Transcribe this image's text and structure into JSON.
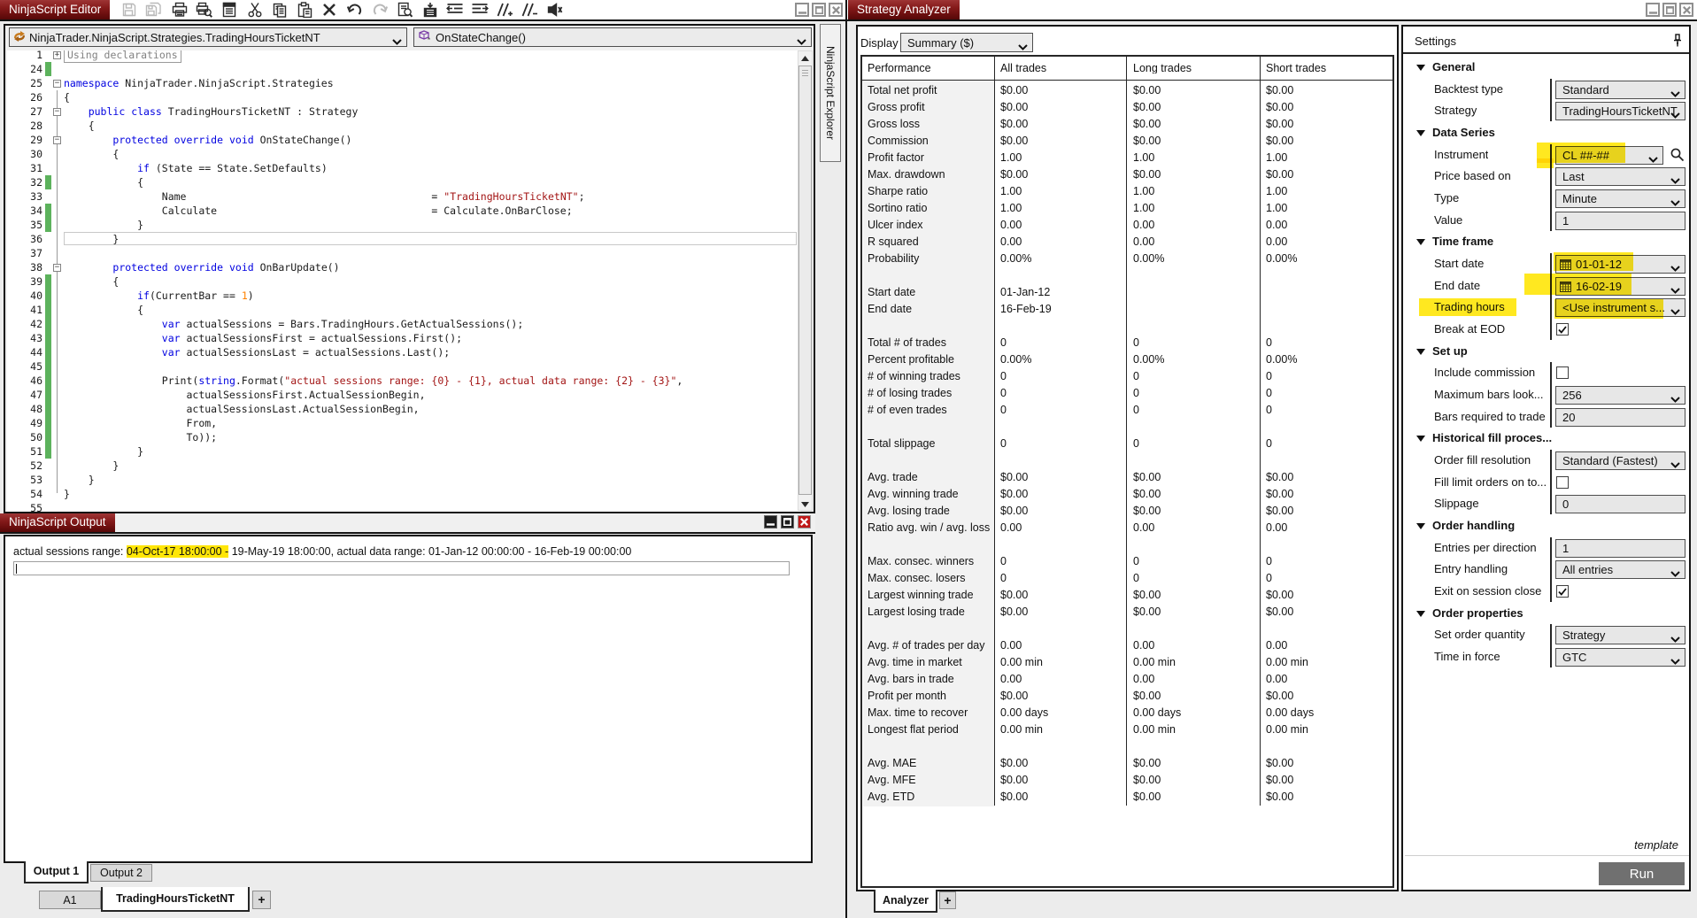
{
  "editor": {
    "title": "NinjaScript Editor",
    "toolbar": [
      {
        "name": "save",
        "disabled": true
      },
      {
        "name": "save-all",
        "disabled": true
      },
      {
        "name": "print",
        "disabled": false
      },
      {
        "name": "print-preview",
        "disabled": false
      },
      {
        "name": "template",
        "disabled": false
      },
      {
        "name": "cut",
        "disabled": false
      },
      {
        "name": "copy",
        "disabled": false
      },
      {
        "name": "paste",
        "disabled": false
      },
      {
        "name": "delete",
        "disabled": false
      },
      {
        "name": "undo",
        "disabled": false
      },
      {
        "name": "redo",
        "disabled": true
      },
      {
        "name": "find",
        "disabled": false
      },
      {
        "name": "compile",
        "disabled": false
      },
      {
        "name": "outdent",
        "disabled": false
      },
      {
        "name": "indent",
        "disabled": false
      },
      {
        "name": "comment",
        "disabled": false
      },
      {
        "name": "uncomment",
        "disabled": false
      },
      {
        "name": "mute",
        "disabled": false
      }
    ],
    "class_dropdown": "NinjaTrader.NinjaScript.Strategies.TradingHoursTicketNT",
    "method_dropdown": "OnStateChange()",
    "explorer_tab": "NinjaScript Explorer",
    "collapsed_region": "Using declarations",
    "code_lines": [
      {
        "num": "1",
        "green": false,
        "fold": "plus",
        "collapsed": true,
        "tokens": []
      },
      {
        "num": "24",
        "green": true,
        "fold": "",
        "tokens": []
      },
      {
        "num": "25",
        "green": false,
        "fold": "minus",
        "tokens": [
          [
            "k",
            "namespace"
          ],
          [
            "p",
            " NinjaTrader.NinjaScript.Strategies"
          ]
        ]
      },
      {
        "num": "26",
        "green": false,
        "fold": "",
        "tokens": [
          [
            "p",
            "{"
          ]
        ]
      },
      {
        "num": "27",
        "green": false,
        "fold": "minus",
        "tokens": [
          [
            "p",
            "    "
          ],
          [
            "k",
            "public"
          ],
          [
            "p",
            " "
          ],
          [
            "k",
            "class"
          ],
          [
            "p",
            " TradingHoursTicketNT : Strategy"
          ]
        ]
      },
      {
        "num": "28",
        "green": false,
        "fold": "",
        "tokens": [
          [
            "p",
            "    {"
          ]
        ]
      },
      {
        "num": "29",
        "green": false,
        "fold": "minus",
        "tokens": [
          [
            "p",
            "        "
          ],
          [
            "k",
            "protected"
          ],
          [
            "p",
            " "
          ],
          [
            "k",
            "override"
          ],
          [
            "p",
            " "
          ],
          [
            "k",
            "void"
          ],
          [
            "p",
            " OnStateChange()"
          ]
        ]
      },
      {
        "num": "30",
        "green": false,
        "fold": "",
        "tokens": [
          [
            "p",
            "        {"
          ]
        ]
      },
      {
        "num": "31",
        "green": false,
        "fold": "",
        "tokens": [
          [
            "p",
            "            "
          ],
          [
            "k",
            "if"
          ],
          [
            "p",
            " (State == State.SetDefaults)"
          ]
        ]
      },
      {
        "num": "32",
        "green": true,
        "fold": "",
        "tokens": [
          [
            "p",
            "            {"
          ]
        ]
      },
      {
        "num": "33",
        "green": false,
        "fold": "",
        "tokens": [
          [
            "p",
            "                Name                                        = "
          ],
          [
            "s",
            "\"TradingHoursTicketNT\""
          ],
          [
            "p",
            ";"
          ]
        ]
      },
      {
        "num": "34",
        "green": true,
        "fold": "",
        "tokens": [
          [
            "p",
            "                Calculate                                   = Calculate.OnBarClose;"
          ]
        ]
      },
      {
        "num": "35",
        "green": true,
        "fold": "",
        "tokens": [
          [
            "p",
            "            }"
          ]
        ]
      },
      {
        "num": "36",
        "green": false,
        "fold": "",
        "caret": true,
        "tokens": [
          [
            "p",
            "        }"
          ]
        ]
      },
      {
        "num": "37",
        "green": false,
        "fold": "",
        "tokens": []
      },
      {
        "num": "38",
        "green": false,
        "fold": "minus",
        "tokens": [
          [
            "p",
            "        "
          ],
          [
            "k",
            "protected"
          ],
          [
            "p",
            " "
          ],
          [
            "k",
            "override"
          ],
          [
            "p",
            " "
          ],
          [
            "k",
            "void"
          ],
          [
            "p",
            " OnBarUpdate()"
          ]
        ]
      },
      {
        "num": "39",
        "green": true,
        "fold": "",
        "tokens": [
          [
            "p",
            "        {"
          ]
        ]
      },
      {
        "num": "40",
        "green": true,
        "fold": "",
        "tokens": [
          [
            "p",
            "            "
          ],
          [
            "k",
            "if"
          ],
          [
            "p",
            "(CurrentBar == "
          ],
          [
            "n",
            "1"
          ],
          [
            "p",
            ")"
          ]
        ]
      },
      {
        "num": "41",
        "green": true,
        "fold": "",
        "tokens": [
          [
            "p",
            "            {"
          ]
        ]
      },
      {
        "num": "42",
        "green": true,
        "fold": "",
        "tokens": [
          [
            "p",
            "                "
          ],
          [
            "k",
            "var"
          ],
          [
            "p",
            " actualSessions = Bars.TradingHours.GetActualSessions();"
          ]
        ]
      },
      {
        "num": "43",
        "green": true,
        "fold": "",
        "tokens": [
          [
            "p",
            "                "
          ],
          [
            "k",
            "var"
          ],
          [
            "p",
            " actualSessionsFirst = actualSessions.First();"
          ]
        ]
      },
      {
        "num": "44",
        "green": true,
        "fold": "",
        "tokens": [
          [
            "p",
            "                "
          ],
          [
            "k",
            "var"
          ],
          [
            "p",
            " actualSessionsLast = actualSessions.Last();"
          ]
        ]
      },
      {
        "num": "45",
        "green": true,
        "fold": "",
        "tokens": []
      },
      {
        "num": "46",
        "green": true,
        "fold": "",
        "tokens": [
          [
            "p",
            "                Print("
          ],
          [
            "k",
            "string"
          ],
          [
            "p",
            ".Format("
          ],
          [
            "s",
            "\"actual sessions range: {0} - {1}, actual data range: {2} - {3}\""
          ],
          [
            "p",
            ","
          ]
        ]
      },
      {
        "num": "47",
        "green": true,
        "fold": "",
        "tokens": [
          [
            "p",
            "                    actualSessionsFirst.ActualSessionBegin,"
          ]
        ]
      },
      {
        "num": "48",
        "green": true,
        "fold": "",
        "tokens": [
          [
            "p",
            "                    actualSessionsLast.ActualSessionBegin,"
          ]
        ]
      },
      {
        "num": "49",
        "green": true,
        "fold": "",
        "tokens": [
          [
            "p",
            "                    From,"
          ]
        ]
      },
      {
        "num": "50",
        "green": true,
        "fold": "",
        "tokens": [
          [
            "p",
            "                    To));"
          ]
        ]
      },
      {
        "num": "51",
        "green": true,
        "fold": "",
        "tokens": [
          [
            "p",
            "            }"
          ]
        ]
      },
      {
        "num": "52",
        "green": false,
        "fold": "",
        "tokens": [
          [
            "p",
            "        }"
          ]
        ]
      },
      {
        "num": "53",
        "green": false,
        "fold": "",
        "tokens": [
          [
            "p",
            "    }"
          ]
        ]
      },
      {
        "num": "54",
        "green": false,
        "fold": "",
        "tokens": [
          [
            "p",
            "}"
          ]
        ]
      },
      {
        "num": "55",
        "green": false,
        "fold": "",
        "tokens": []
      }
    ],
    "file_tabs": {
      "tab1": "A1",
      "tab2": "TradingHoursTicketNT",
      "add": "+"
    }
  },
  "output": {
    "title": "NinjaScript Output",
    "line_prefix": "actual sessions range: ",
    "line_highlight": "04-Oct-17 18:00:00 -",
    "line_rest": " 19-May-19 18:00:00, actual data range: 01-Jan-12 00:00:00 - 16-Feb-19 00:00:00",
    "tab1": "Output 1",
    "tab2": "Output 2"
  },
  "analyzer": {
    "title": "Strategy Analyzer",
    "display_label": "Display",
    "display_value": "Summary ($)",
    "tab": "Analyzer",
    "add_tab": "+",
    "table": {
      "headers": [
        "Performance",
        "All trades",
        "Long trades",
        "Short trades"
      ],
      "rows": [
        [
          "Total net profit",
          "$0.00",
          "$0.00",
          "$0.00"
        ],
        [
          "Gross profit",
          "$0.00",
          "$0.00",
          "$0.00"
        ],
        [
          "Gross loss",
          "$0.00",
          "$0.00",
          "$0.00"
        ],
        [
          "Commission",
          "$0.00",
          "$0.00",
          "$0.00"
        ],
        [
          "Profit factor",
          "1.00",
          "1.00",
          "1.00"
        ],
        [
          "Max. drawdown",
          "$0.00",
          "$0.00",
          "$0.00"
        ],
        [
          "Sharpe ratio",
          "1.00",
          "1.00",
          "1.00"
        ],
        [
          "Sortino ratio",
          "1.00",
          "1.00",
          "1.00"
        ],
        [
          "Ulcer index",
          "0.00",
          "0.00",
          "0.00"
        ],
        [
          "R squared",
          "0.00",
          "0.00",
          "0.00"
        ],
        [
          "Probability",
          "0.00%",
          "0.00%",
          "0.00%"
        ],
        [
          "",
          "",
          "",
          ""
        ],
        [
          "Start date",
          "01-Jan-12",
          "",
          ""
        ],
        [
          "End date",
          "16-Feb-19",
          "",
          ""
        ],
        [
          "",
          "",
          "",
          ""
        ],
        [
          "Total # of trades",
          "0",
          "0",
          "0"
        ],
        [
          "Percent profitable",
          "0.00%",
          "0.00%",
          "0.00%"
        ],
        [
          "# of winning trades",
          "0",
          "0",
          "0"
        ],
        [
          "# of losing trades",
          "0",
          "0",
          "0"
        ],
        [
          "# of even trades",
          "0",
          "0",
          "0"
        ],
        [
          "",
          "",
          "",
          ""
        ],
        [
          "Total slippage",
          "0",
          "0",
          "0"
        ],
        [
          "",
          "",
          "",
          ""
        ],
        [
          "Avg. trade",
          "$0.00",
          "$0.00",
          "$0.00"
        ],
        [
          "Avg. winning trade",
          "$0.00",
          "$0.00",
          "$0.00"
        ],
        [
          "Avg. losing trade",
          "$0.00",
          "$0.00",
          "$0.00"
        ],
        [
          "Ratio avg. win / avg. loss",
          "0.00",
          "0.00",
          "0.00"
        ],
        [
          "",
          "",
          "",
          ""
        ],
        [
          "Max. consec. winners",
          "0",
          "0",
          "0"
        ],
        [
          "Max. consec. losers",
          "0",
          "0",
          "0"
        ],
        [
          "Largest winning trade",
          "$0.00",
          "$0.00",
          "$0.00"
        ],
        [
          "Largest losing trade",
          "$0.00",
          "$0.00",
          "$0.00"
        ],
        [
          "",
          "",
          "",
          ""
        ],
        [
          "Avg. # of trades per day",
          "0.00",
          "0.00",
          "0.00"
        ],
        [
          "Avg. time in market",
          "0.00 min",
          "0.00 min",
          "0.00 min"
        ],
        [
          "Avg. bars in trade",
          "0.00",
          "0.00",
          "0.00"
        ],
        [
          "Profit per month",
          "$0.00",
          "$0.00",
          "$0.00"
        ],
        [
          "Max. time to recover",
          "0.00 days",
          "0.00 days",
          "0.00 days"
        ],
        [
          "Longest flat period",
          "0.00 min",
          "0.00 min",
          "0.00 min"
        ],
        [
          "",
          "",
          "",
          ""
        ],
        [
          "Avg. MAE",
          "$0.00",
          "$0.00",
          "$0.00"
        ],
        [
          "Avg. MFE",
          "$0.00",
          "$0.00",
          "$0.00"
        ],
        [
          "Avg. ETD",
          "$0.00",
          "$0.00",
          "$0.00"
        ]
      ]
    }
  },
  "settings": {
    "title": "Settings",
    "template_link": "template",
    "run_button": "Run",
    "sections": [
      {
        "label": "General",
        "rows": [
          {
            "label": "Backtest type",
            "control": {
              "type": "select",
              "value": "Standard"
            }
          },
          {
            "label": "Strategy",
            "control": {
              "type": "select",
              "value": "TradingHoursTicketNT"
            }
          }
        ]
      },
      {
        "label": "Data Series",
        "rows": [
          {
            "label": "Instrument",
            "control": {
              "type": "select",
              "value": "CL ##-##",
              "narrow": true,
              "search": true
            }
          },
          {
            "label": "Price based on",
            "control": {
              "type": "select",
              "value": "Last"
            }
          },
          {
            "label": "Type",
            "control": {
              "type": "select",
              "value": "Minute"
            }
          },
          {
            "label": "Value",
            "control": {
              "type": "input",
              "value": "1"
            }
          }
        ]
      },
      {
        "label": "Time frame",
        "rows": [
          {
            "label": "Start date",
            "control": {
              "type": "date",
              "value": "01-01-12"
            }
          },
          {
            "label": "End date",
            "control": {
              "type": "date",
              "value": "16-02-19"
            }
          },
          {
            "label": "Trading hours",
            "control": {
              "type": "select",
              "value": "<Use instrument s..."
            }
          },
          {
            "label": "Break at EOD",
            "control": {
              "type": "checkbox",
              "checked": true
            }
          }
        ]
      },
      {
        "label": "Set up",
        "rows": [
          {
            "label": "Include commission",
            "control": {
              "type": "checkbox",
              "checked": false
            }
          },
          {
            "label": "Maximum bars look...",
            "control": {
              "type": "select",
              "value": "256"
            }
          },
          {
            "label": "Bars required to trade",
            "control": {
              "type": "input",
              "value": "20"
            }
          }
        ]
      },
      {
        "label": "Historical fill proces...",
        "rows": [
          {
            "label": "Order fill resolution",
            "control": {
              "type": "select",
              "value": "Standard (Fastest)"
            }
          },
          {
            "label": "Fill limit orders on to...",
            "control": {
              "type": "checkbox",
              "checked": false
            }
          },
          {
            "label": "Slippage",
            "control": {
              "type": "input",
              "value": "0"
            }
          }
        ]
      },
      {
        "label": "Order handling",
        "rows": [
          {
            "label": "Entries per direction",
            "control": {
              "type": "input",
              "value": "1"
            }
          },
          {
            "label": "Entry handling",
            "control": {
              "type": "select",
              "value": "All entries"
            }
          },
          {
            "label": "Exit on session close",
            "control": {
              "type": "checkbox",
              "checked": true
            }
          }
        ]
      },
      {
        "label": "Order properties",
        "rows": [
          {
            "label": "Set order quantity",
            "control": {
              "type": "select",
              "value": "Strategy"
            }
          },
          {
            "label": "Time in force",
            "control": {
              "type": "select",
              "value": "GTC"
            }
          }
        ]
      }
    ]
  }
}
